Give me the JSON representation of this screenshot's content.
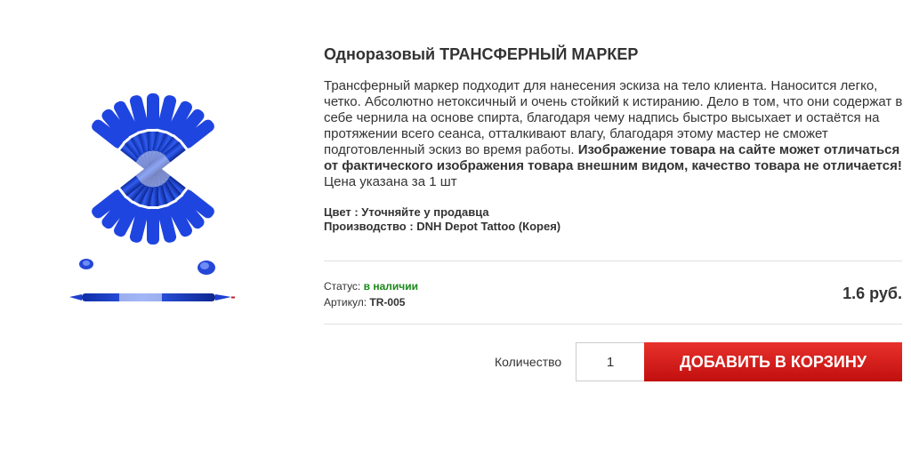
{
  "product": {
    "title": "Одноразовый ТРАНСФЕРНЫЙ МАРКЕР",
    "description": "Трансферный маркер подходит для нанесения эскиза на тело клиента. Наносится легко, четко. Абсолютно нетоксичный и очень стойкий к истиранию. Дело в том, что они содержат в себе чернила на основе спирта, благодаря чему надпись быстро высыхает и остаётся на протяжении всего сеанса, отталкивают влагу, благодаря этому мастер не сможет подготовленный эскиз во время работы.",
    "warning": "Изображение товара на сайте может отличаться от фактического изображения товара внешним видом, качество товара не отличается!",
    "price_note": "Цена указана за 1 шт",
    "color": "Цвет : Уточняйте у продавца",
    "production": "Производство : DNH Depot Tattoo (Корея)",
    "status_label": "Статус:",
    "status_value": "в наличии",
    "article_label": "Артикул:",
    "article_value": "TR-005",
    "price": "1.6 руб.",
    "quantity_label": "Количество",
    "quantity_value": "1",
    "add_to_cart": "ДОБАВИТЬ В КОРЗИНУ",
    "image_icon": "blue-transfer-markers-photo"
  },
  "colors": {
    "marker_blue": "#1a3fd6",
    "status_green": "#1a8a1a",
    "button_red": "#d8201c"
  }
}
